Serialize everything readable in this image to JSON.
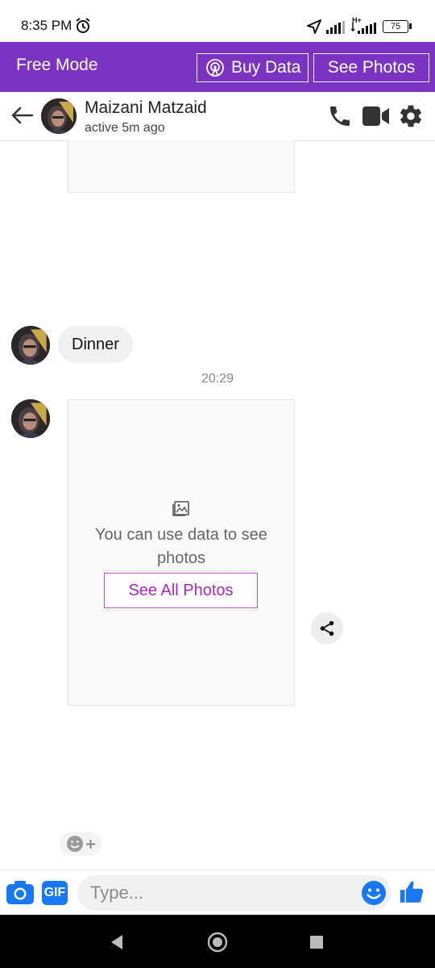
{
  "status_bar": {
    "time": "8:35 PM",
    "network": "H+",
    "battery": "75"
  },
  "banner": {
    "title": "Free Mode",
    "buy_data_label": "Buy Data",
    "see_photos_label": "See Photos"
  },
  "header": {
    "contact_name": "Maizani Matzaid",
    "contact_status": "active 5m ago"
  },
  "messages": {
    "dinner_text": "Dinner",
    "timestamp": "20:29",
    "photo_notice": "You can use data to see photos",
    "see_all_label": "See All Photos"
  },
  "composer": {
    "placeholder": "Type...",
    "gif_label": "GIF"
  },
  "colors": {
    "banner": "#7b34c2",
    "accent_blue": "#1877f2",
    "see_all_purple": "#a52bb8"
  }
}
